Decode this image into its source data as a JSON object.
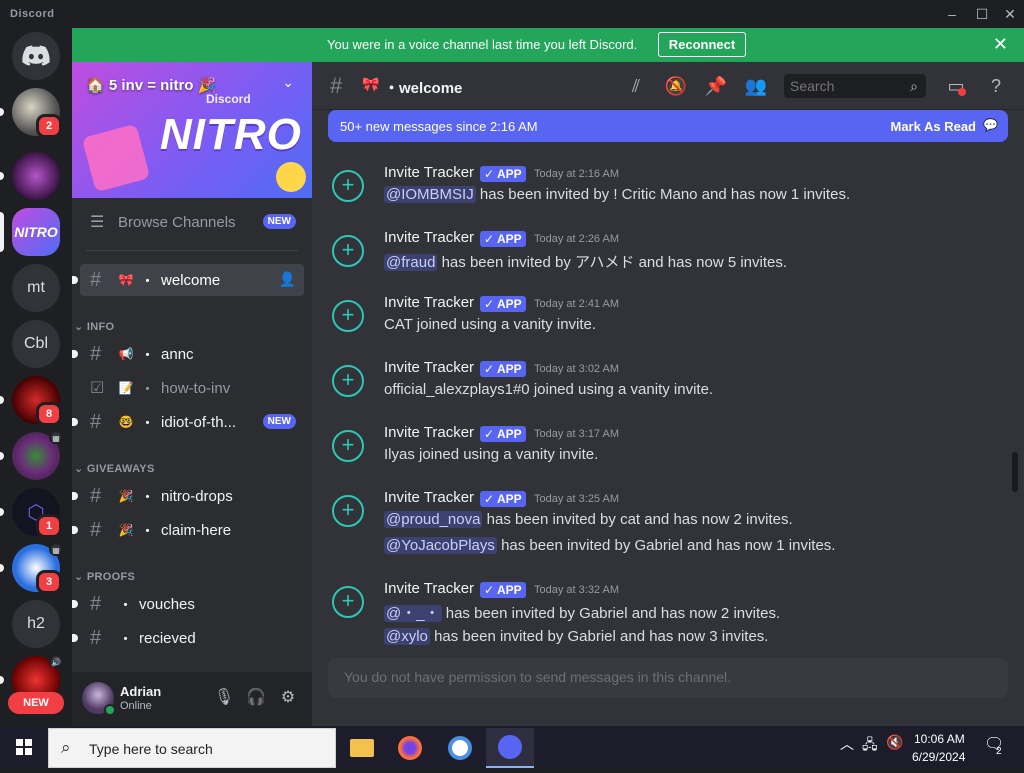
{
  "window": {
    "title": "Discord"
  },
  "banner": {
    "message": "You were in a voice channel last time you left Discord.",
    "button": "Reconnect"
  },
  "guilds": {
    "badges": [
      "2",
      "8",
      "1",
      "3"
    ],
    "text_items": [
      "mt",
      "Cbl",
      "h2"
    ],
    "new_label": "NEW"
  },
  "server": {
    "name": "5 inv = nitro",
    "banner_text": "NITRO",
    "banner_brand": "Discord"
  },
  "sidebar": {
    "browse": "Browse Channels",
    "browse_tag": "NEW",
    "channels": [
      {
        "name": "welcome"
      },
      {
        "category": "INFO"
      },
      {
        "name": "annc"
      },
      {
        "name": "how-to-inv"
      },
      {
        "name": "idiot-of-th...",
        "tag": "NEW"
      },
      {
        "category": "GIVEAWAYS"
      },
      {
        "name": "nitro-drops"
      },
      {
        "name": "claim-here"
      },
      {
        "category": "PROOFS"
      },
      {
        "name": "vouches"
      },
      {
        "name": "recieved"
      }
    ]
  },
  "user": {
    "name": "Adrian",
    "status": "Online"
  },
  "channel_header": {
    "name": "welcome",
    "search_placeholder": "Search"
  },
  "new_messages": {
    "text": "50+ new messages since 2:16 AM",
    "action": "Mark As Read"
  },
  "messages": [
    {
      "author": "Invite Tracker",
      "tag": "APP",
      "time": "Today at 2:16 AM",
      "lines": [
        {
          "mention": "@IOMBMSIJ",
          "text": "has been invited by !              Critic Mano and has now 1 invites."
        }
      ]
    },
    {
      "author": "Invite Tracker",
      "tag": "APP",
      "time": "Today at 2:26 AM",
      "lines": [
        {
          "mention": "@fraud",
          "text": "has been invited by アハメド and has now 5 invites."
        }
      ]
    },
    {
      "author": "Invite Tracker",
      "tag": "APP",
      "time": "Today at 2:41 AM",
      "lines": [
        {
          "mention": "",
          "text": "CAT joined using a vanity invite."
        }
      ]
    },
    {
      "author": "Invite Tracker",
      "tag": "APP",
      "time": "Today at 3:02 AM",
      "lines": [
        {
          "mention": "",
          "text": "official_alexzplays1#0 joined using a vanity invite."
        }
      ]
    },
    {
      "author": "Invite Tracker",
      "tag": "APP",
      "time": "Today at 3:17 AM",
      "lines": [
        {
          "mention": "",
          "text": "Ilyas joined using a vanity invite."
        }
      ]
    },
    {
      "author": "Invite Tracker",
      "tag": "APP",
      "time": "Today at 3:25 AM",
      "lines": [
        {
          "mention": "@proud_nova",
          "text": "has been invited by cat and has now 2 invites."
        },
        {
          "mention": "@YoJacobPlays",
          "text": "has been invited by Gabriel and has now 1 invites."
        }
      ]
    },
    {
      "author": "Invite Tracker",
      "tag": "APP",
      "time": "Today at 3:32 AM",
      "lines": [
        {
          "mention": "@・_・",
          "text": "has been invited by Gabriel and has now 2 invites."
        },
        {
          "mention": "@xylo",
          "text": "has been invited by Gabriel and has now 3 invites."
        }
      ]
    }
  ],
  "composer": {
    "placeholder": "You do not have permission to send messages in this channel."
  },
  "taskbar": {
    "search": "Type here to search",
    "time": "10:06 AM",
    "date": "6/29/2024",
    "notif_count": "2"
  },
  "colors": {
    "accent": "#5865f2",
    "banner": "#23a55a",
    "bg": "#313338",
    "sidebar": "#2b2d31"
  }
}
